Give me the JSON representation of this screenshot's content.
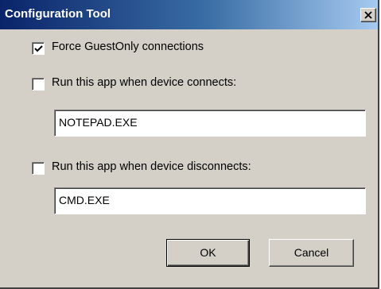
{
  "window": {
    "title": "Configuration Tool",
    "close_glyph": "×"
  },
  "options": [
    {
      "label": "Force GuestOnly connections",
      "checked": true
    },
    {
      "label": "Run this app when device connects:",
      "checked": false
    },
    {
      "label": "Run this app when device disconnects:",
      "checked": false
    }
  ],
  "fields": {
    "connect_app": {
      "value": "NOTEPAD.EXE"
    },
    "disconnect_app": {
      "value": "CMD.EXE"
    }
  },
  "buttons": {
    "ok_label": "OK",
    "cancel_label": "Cancel"
  },
  "icons": {
    "close": "close-icon",
    "check": "checkmark-icon"
  },
  "colors": {
    "face": "#d4d0c8",
    "title_start": "#0a246a",
    "title_end": "#a6caf0"
  }
}
